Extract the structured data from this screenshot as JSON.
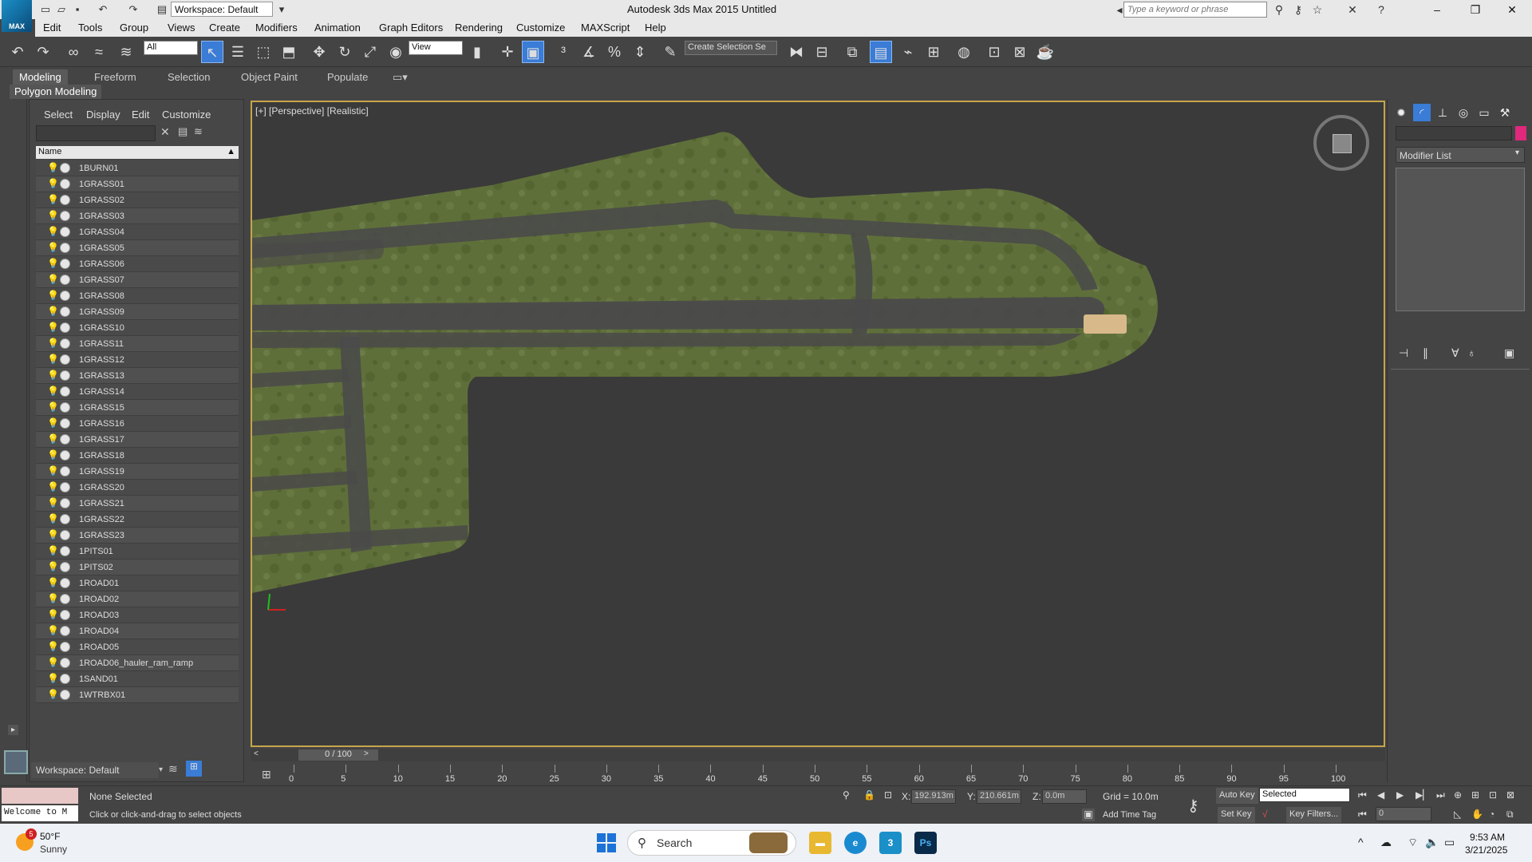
{
  "titlebar": {
    "title": "Autodesk 3ds Max  2015     Untitled",
    "workspace": "Workspace: Default",
    "search_placeholder": "Type a keyword or phrase"
  },
  "menu": [
    "Edit",
    "Tools",
    "Group",
    "Views",
    "Create",
    "Modifiers",
    "Animation",
    "Graph Editors",
    "Rendering",
    "Customize",
    "MAXScript",
    "Help"
  ],
  "toolbar": {
    "selection_filter": "All",
    "reference_coord": "View",
    "create_selection_set": "Create Selection Se"
  },
  "ribbon": {
    "tabs": [
      "Modeling",
      "Freeform",
      "Selection",
      "Object Paint",
      "Populate"
    ],
    "subpanel": "Polygon Modeling"
  },
  "scene_explorer": {
    "menu": [
      "Select",
      "Display",
      "Edit",
      "Customize"
    ],
    "column_header": "Name",
    "objects": [
      "1BURN01",
      "1GRASS01",
      "1GRASS02",
      "1GRASS03",
      "1GRASS04",
      "1GRASS05",
      "1GRASS06",
      "1GRASS07",
      "1GRASS08",
      "1GRASS09",
      "1GRASS10",
      "1GRASS11",
      "1GRASS12",
      "1GRASS13",
      "1GRASS14",
      "1GRASS15",
      "1GRASS16",
      "1GRASS17",
      "1GRASS18",
      "1GRASS19",
      "1GRASS20",
      "1GRASS21",
      "1GRASS22",
      "1GRASS23",
      "1PITS01",
      "1PITS02",
      "1ROAD01",
      "1ROAD02",
      "1ROAD03",
      "1ROAD04",
      "1ROAD05",
      "1ROAD06_hauler_ram_ramp",
      "1SAND01",
      "1WTRBX01"
    ],
    "workspace": "Workspace: Default"
  },
  "viewport": {
    "label": "[+] [Perspective] [Realistic]"
  },
  "command_panel": {
    "modifier_list": "Modifier List"
  },
  "timeline": {
    "frame": "0 / 100",
    "ticks": [
      "0",
      "5",
      "10",
      "15",
      "20",
      "25",
      "30",
      "35",
      "40",
      "45",
      "50",
      "55",
      "60",
      "65",
      "70",
      "75",
      "80",
      "85",
      "90",
      "95",
      "100"
    ]
  },
  "status": {
    "listener": "Welcome to M",
    "selection": "None Selected",
    "prompt": "Click or click-and-drag to select objects",
    "x_label": "X:",
    "x": "192.913m",
    "y_label": "Y:",
    "y": "210.661m",
    "z_label": "Z:",
    "z": "0.0m",
    "grid": "Grid = 10.0m",
    "add_time_tag": "Add Time Tag",
    "auto_key": "Auto Key",
    "set_key": "Set Key",
    "key_mode": "Selected",
    "key_filters": "Key Filters...",
    "frame": "0"
  },
  "taskbar": {
    "temp": "50°F",
    "condition": "Sunny",
    "badge": "5",
    "search": "Search",
    "time": "9:53 AM",
    "date": "3/21/2025"
  },
  "colors": {
    "grass": "#5f6f3a",
    "road": "#4a4a4a",
    "sand": "#d8b98a",
    "viewport_border": "#c8a54b",
    "object_color": "#e0287c"
  }
}
